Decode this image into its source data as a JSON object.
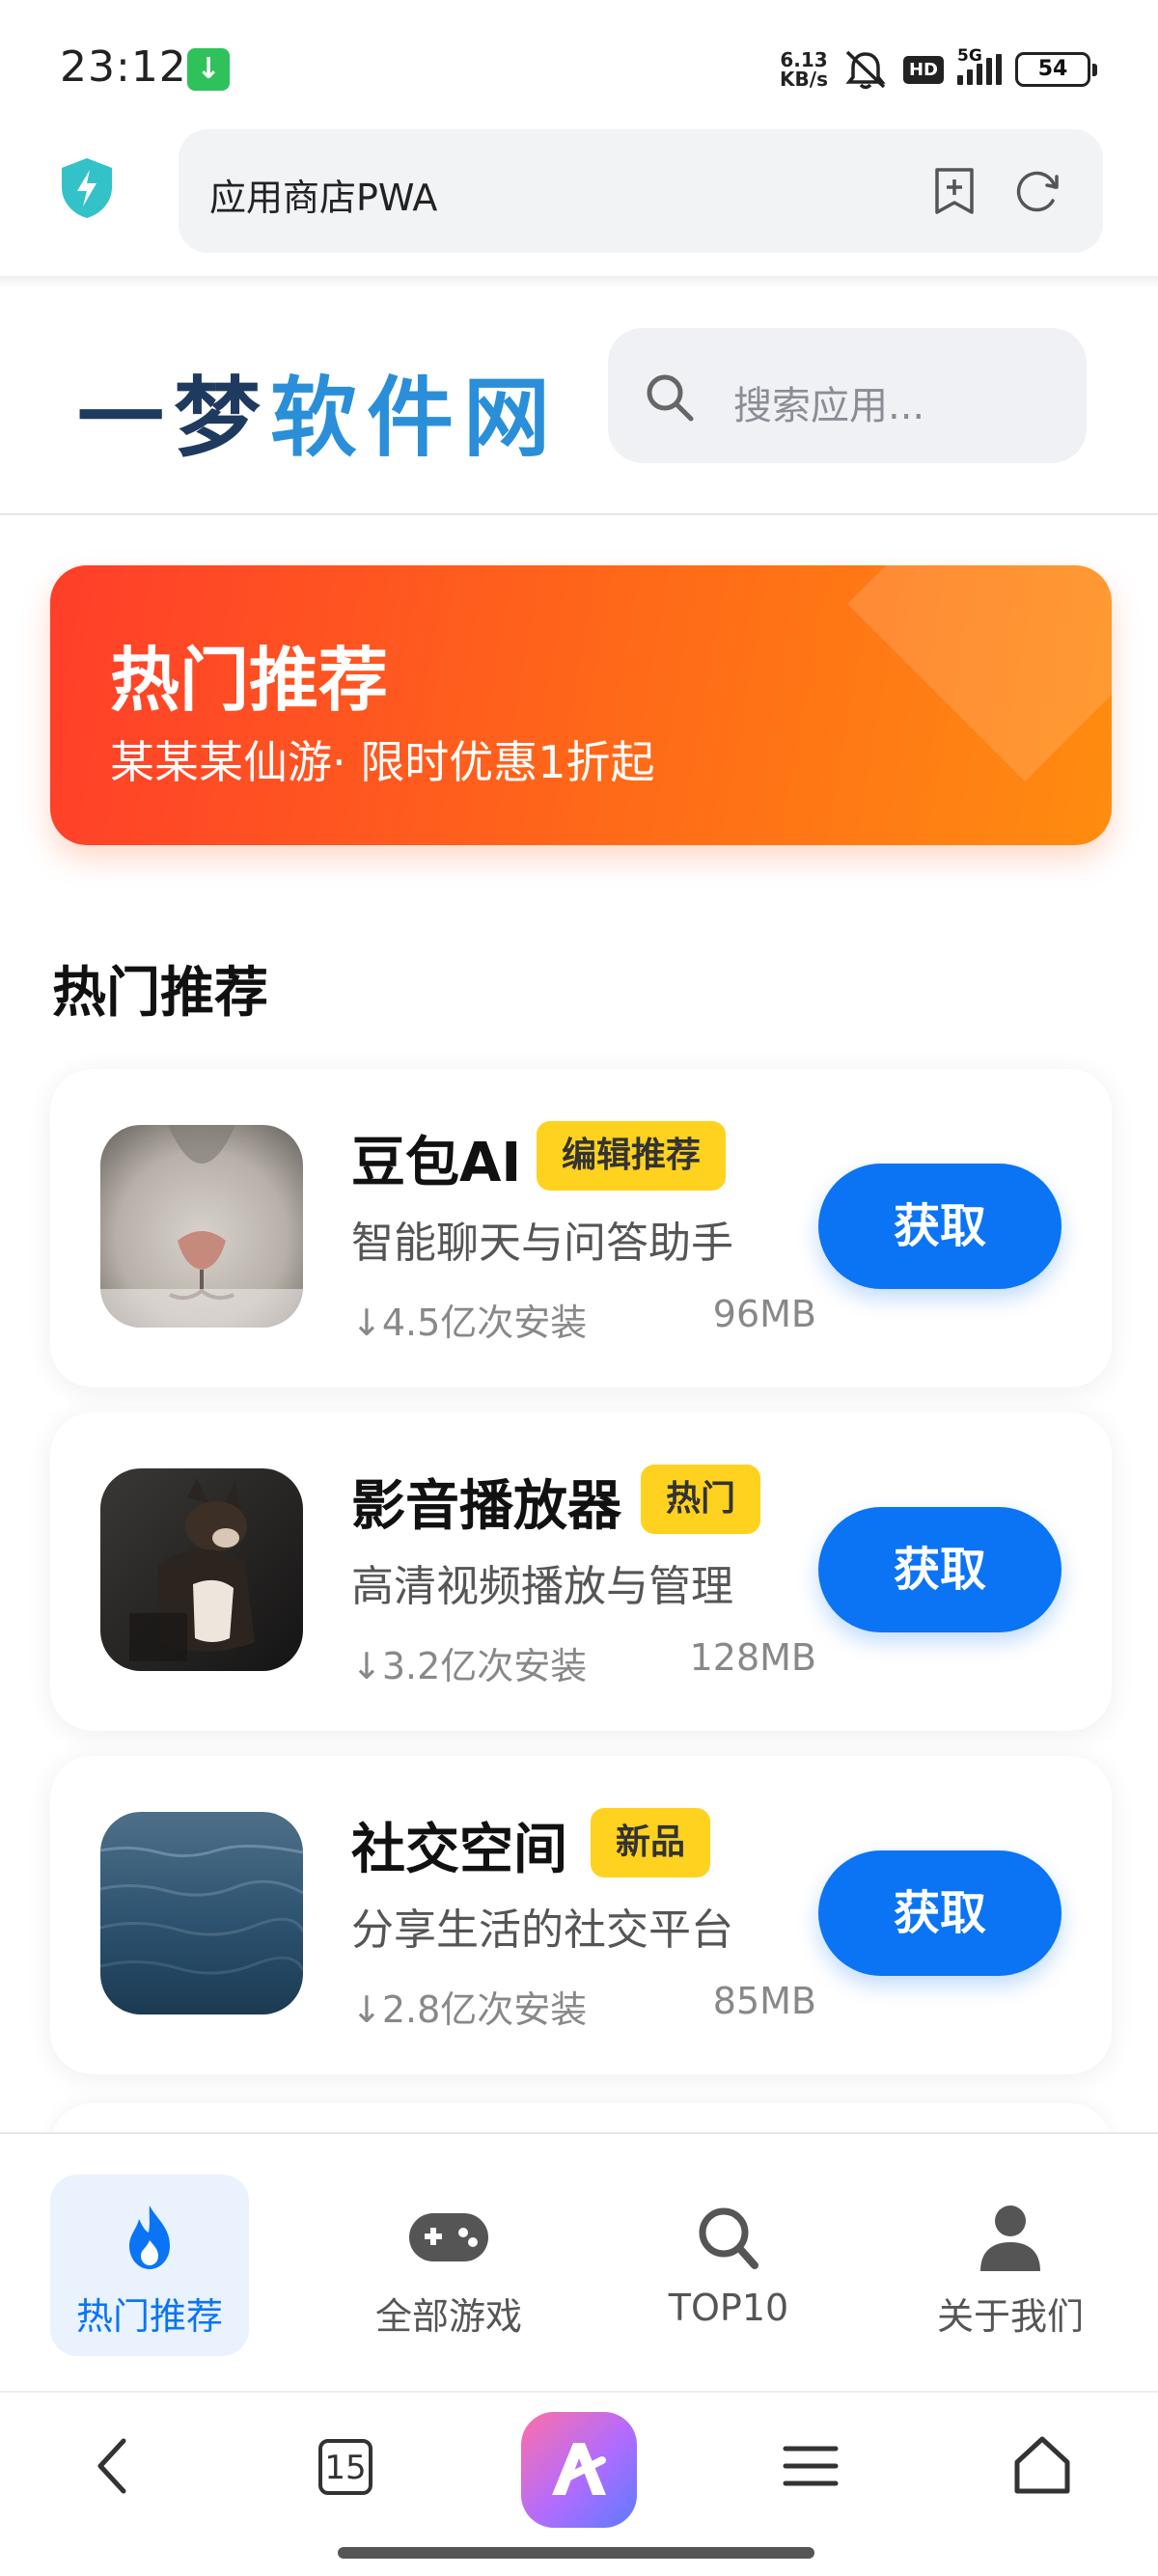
{
  "status_bar": {
    "time": "23:12",
    "net_speed_value": "6.13",
    "net_speed_unit": "KB/s",
    "hd": "HD",
    "network": "5G",
    "battery": "54"
  },
  "browser": {
    "url_title": "应用商店PWA",
    "tab_count": "15"
  },
  "site": {
    "logo_part1": "一梦",
    "logo_part2": "软件网",
    "search_placeholder": "搜索应用..."
  },
  "banner": {
    "title": "热门推荐",
    "subtitle": "某某某仙游· 限时优惠1折起"
  },
  "section_title": "热门推荐",
  "apps": [
    {
      "name": "豆包AI",
      "tag": "编辑推荐",
      "desc": "智能聊天与问答助手",
      "installs": "↓4.5亿次安装",
      "size": "96MB",
      "button": "获取",
      "icon": "cat-nose-photo"
    },
    {
      "name": "影音播放器",
      "tag": "热门",
      "desc": "高清视频播放与管理",
      "installs": "↓3.2亿次安装",
      "size": "128MB",
      "button": "获取",
      "icon": "dog-photo"
    },
    {
      "name": "社交空间",
      "tag": "新品",
      "desc": "分享生活的社交平台",
      "installs": "↓2.8亿次安装",
      "size": "85MB",
      "button": "获取",
      "icon": "ocean-photo"
    }
  ],
  "bottom_nav": [
    {
      "label": "热门推荐",
      "icon": "flame-icon",
      "active": true
    },
    {
      "label": "全部游戏",
      "icon": "gamepad-icon",
      "active": false
    },
    {
      "label": "TOP10",
      "icon": "search-icon",
      "active": false
    },
    {
      "label": "关于我们",
      "icon": "user-icon",
      "active": false
    }
  ],
  "colors": {
    "accent": "#0a74f5",
    "tag": "#ffd21f",
    "banner_start": "#ff3e2a",
    "banner_end": "#ff8c10",
    "logo_dark": "#1f3a5f",
    "logo_blue": "#2a8fd8"
  }
}
